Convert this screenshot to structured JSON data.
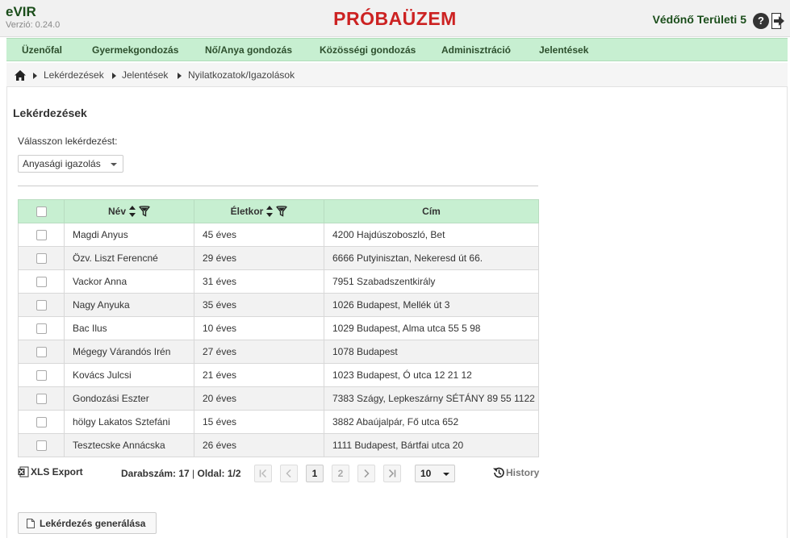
{
  "app": {
    "name": "eVIR",
    "version": "Verzió: 0.24.0",
    "environment_title": "PRÓBAÜZEM",
    "user": "Védőnő Területi 5",
    "help_label": "?"
  },
  "nav": {
    "items": [
      {
        "label": "Üzenőfal"
      },
      {
        "label": "Gyermekgondozás"
      },
      {
        "label": "Nő/Anya gondozás"
      },
      {
        "label": "Közösségi gondozás"
      },
      {
        "label": "Adminisztráció"
      },
      {
        "label": "Jelentések"
      }
    ]
  },
  "breadcrumb": [
    "Lekérdezések",
    "Jelentések",
    "Nyilatkozatok/Igazolások"
  ],
  "page": {
    "title": "Lekérdezések",
    "select_label": "Válasszon lekérdezést:",
    "select_value": "Anyasági igazolás"
  },
  "table": {
    "columns": [
      "Név",
      "Életkor",
      "Cím"
    ],
    "rows": [
      {
        "name": "Magdi Anyus",
        "age": "45 éves",
        "address": "4200 Hajdúszoboszló, Bet"
      },
      {
        "name": "Özv. Liszt Ferencné",
        "age": "29 éves",
        "address": "6666 Putyinisztan, Nekeresd út 66."
      },
      {
        "name": "Vackor Anna",
        "age": "31 éves",
        "address": "7951 Szabadszentkirály"
      },
      {
        "name": "Nagy Anyuka",
        "age": "35 éves",
        "address": "1026 Budapest, Mellék út 3"
      },
      {
        "name": "Bac Ilus",
        "age": "10 éves",
        "address": "1029 Budapest, Alma utca 55 5 98"
      },
      {
        "name": "Mégegy Várandós Irén",
        "age": "27 éves",
        "address": "1078 Budapest"
      },
      {
        "name": "Kovács Julcsi",
        "age": "21 éves",
        "address": "1023 Budapest, Ó utca 12 21 12"
      },
      {
        "name": "Gondozási Eszter",
        "age": "20 éves",
        "address": "7383 Szágy, Lepkeszárny SÉTÁNY 89 55 1122"
      },
      {
        "name": "hölgy Lakatos Sztefáni",
        "age": "15 éves",
        "address": "3882 Abaújalpár, Fő utca 652"
      },
      {
        "name": "Tesztecske Annácska",
        "age": "26 éves",
        "address": "1111 Budapest, Bártfai utca 20"
      }
    ]
  },
  "footer": {
    "xls_export": "XLS Export",
    "count_label": "Darabszám: 17",
    "separator": " | ",
    "page_label": "Oldal: 1/2",
    "pages": [
      "1",
      "2"
    ],
    "page_size": "10",
    "history": "History",
    "generate_button": "Lekérdezés generálása"
  }
}
